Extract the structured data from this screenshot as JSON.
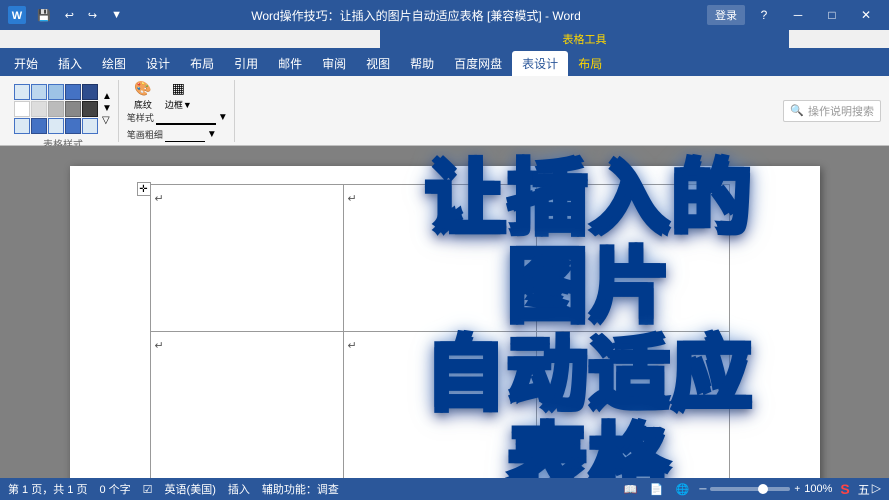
{
  "titleBar": {
    "title": "Word操作技巧：让插入的图片自动适应表格 [兼容模式] - Word",
    "appWord": "Word",
    "contextLabel": "表格工具",
    "loginLabel": "登录",
    "minimize": "─",
    "maximize": "□",
    "close": "✕",
    "undoIcon": "↩",
    "redoIcon": "↪",
    "customizeIcon": "▼"
  },
  "ribbonTabs": [
    {
      "label": "开始",
      "active": false
    },
    {
      "label": "插入",
      "active": false
    },
    {
      "label": "绘图",
      "active": false
    },
    {
      "label": "设计",
      "active": false
    },
    {
      "label": "布局",
      "active": false
    },
    {
      "label": "引用",
      "active": false
    },
    {
      "label": "邮件",
      "active": false
    },
    {
      "label": "审阅",
      "active": false
    },
    {
      "label": "视图",
      "active": false
    },
    {
      "label": "帮助",
      "active": false
    },
    {
      "label": "百度网盘",
      "active": false
    },
    {
      "label": "表设计",
      "active": true,
      "highlighted": true
    },
    {
      "label": "布局",
      "active": false,
      "highlighted": true
    }
  ],
  "contextRibbonLabel": "表格工具",
  "searchPlaceholder": "操作说明搜索",
  "bigTitle": {
    "line1": "让插入的",
    "line2": "图片",
    "line3": "自动适应",
    "line4": "表格",
    "combined": "让插入的\n图片\n自动适应\n表格"
  },
  "statusBar": {
    "pages": "第 1 页，共 1 页",
    "words": "0 个字",
    "checkIcon": "☑",
    "language": "英语(美国)",
    "insertMode": "插入",
    "accessibility": "辅助功能：调查",
    "zoomLevel": "100%",
    "wpsLogo": "S"
  },
  "tableArrows": [
    "↵",
    "↵",
    "↵",
    "↵",
    "↵",
    "↵",
    "↵"
  ]
}
